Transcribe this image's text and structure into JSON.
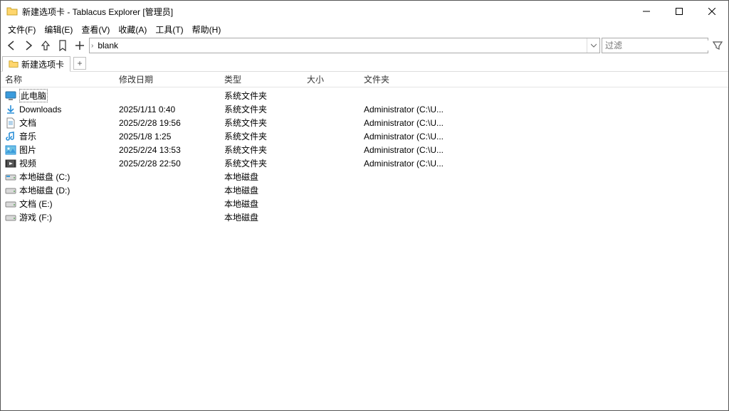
{
  "window": {
    "title": "新建选项卡 - Tablacus Explorer [管理员]"
  },
  "menu": {
    "file": "文件(F)",
    "edit": "编辑(E)",
    "view": "查看(V)",
    "fav": "收藏(A)",
    "tools": "工具(T)",
    "help": "帮助(H)"
  },
  "address": {
    "seg1": "blank"
  },
  "filter": {
    "placeholder": "过滤"
  },
  "tabs": {
    "tab1": "新建选项卡",
    "newtab": "+"
  },
  "columns": {
    "name": "名称",
    "modified": "修改日期",
    "type": "类型",
    "size": "大小",
    "folder": "文件夹"
  },
  "rows": [
    {
      "icon": "pc",
      "name": "此电脑",
      "modified": "",
      "type": "系统文件夹",
      "size": "",
      "folder": "",
      "selected": true
    },
    {
      "icon": "download",
      "name": "Downloads",
      "modified": "2025/1/11 0:40",
      "type": "系统文件夹",
      "size": "",
      "folder": "Administrator (C:\\U..."
    },
    {
      "icon": "doc",
      "name": "文档",
      "modified": "2025/2/28 19:56",
      "type": "系统文件夹",
      "size": "",
      "folder": "Administrator (C:\\U..."
    },
    {
      "icon": "music",
      "name": "音乐",
      "modified": "2025/1/8 1:25",
      "type": "系统文件夹",
      "size": "",
      "folder": "Administrator (C:\\U..."
    },
    {
      "icon": "pic",
      "name": "图片",
      "modified": "2025/2/24 13:53",
      "type": "系统文件夹",
      "size": "",
      "folder": "Administrator (C:\\U..."
    },
    {
      "icon": "video",
      "name": "视频",
      "modified": "2025/2/28 22:50",
      "type": "系统文件夹",
      "size": "",
      "folder": "Administrator (C:\\U..."
    },
    {
      "icon": "drive-c",
      "name": "本地磁盘 (C:)",
      "modified": "",
      "type": "本地磁盘",
      "size": "",
      "folder": ""
    },
    {
      "icon": "drive",
      "name": "本地磁盘 (D:)",
      "modified": "",
      "type": "本地磁盘",
      "size": "",
      "folder": ""
    },
    {
      "icon": "drive",
      "name": "文档 (E:)",
      "modified": "",
      "type": "本地磁盘",
      "size": "",
      "folder": ""
    },
    {
      "icon": "drive",
      "name": "游戏 (F:)",
      "modified": "",
      "type": "本地磁盘",
      "size": "",
      "folder": ""
    }
  ]
}
